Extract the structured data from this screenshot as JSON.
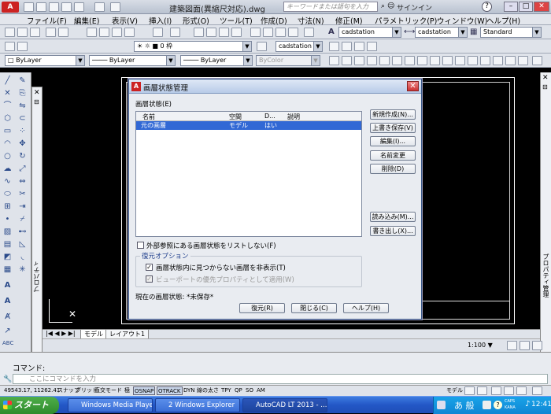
{
  "titlebar": {
    "title": "建築図面(異縮尺対応).dwg",
    "search_placeholder": "キーワードまたは語句を入力",
    "signin": "サインイン"
  },
  "menu": [
    "ファイル(F)",
    "編集(E)",
    "表示(V)",
    "挿入(I)",
    "形式(O)",
    "ツール(T)",
    "作成(D)",
    "寸法(N)",
    "修正(M)",
    "パラメトリック(P)",
    "ウィンドウ(W)",
    "ヘルプ(H)"
  ],
  "toolbar2": {
    "textstyle": "cadstation",
    "dimstyle": "cadstation",
    "tablestyle": "Standard",
    "mlstyle": "cadstation",
    "layer": "0 枠"
  },
  "toolbar3": {
    "color": "ByLayer",
    "linetype": "ByLayer",
    "lineweight": "ByLayer",
    "plotstyle": "ByColor"
  },
  "palettes": {
    "left_label": "プロパティ",
    "right_label": "プロパティ管理"
  },
  "layout_tabs": [
    "モデル",
    "レイアウト1"
  ],
  "scale": "1:100",
  "command": {
    "line1": "コマンド:",
    "placeholder": "ここにコマンドを入力"
  },
  "status": {
    "coords": "49543.17, 11262.41",
    "toggles": [
      "スナップ",
      "グリッド",
      "直交モード",
      "極",
      "OSNAP",
      "OTRACK",
      "DYN",
      "線の太さ",
      "TPY",
      "QP",
      "SO",
      "AM"
    ],
    "model": "モデル"
  },
  "taskbar": {
    "start": "スタート",
    "tasks": [
      "Windows Media Player",
      "2 Windows Explorer",
      "AutoCAD LT 2013 - ..."
    ],
    "ime": "あ 般",
    "caps": "CAPS KANA",
    "time": "12:41"
  },
  "dialog": {
    "title": "画層状態管理",
    "states_label": "画層状態(E)",
    "columns": [
      "名前",
      "空間",
      "D...",
      "説明"
    ],
    "rows": [
      {
        "name": "元の画層",
        "space": "モデル",
        "d": "はい",
        "desc": ""
      }
    ],
    "buttons_right": [
      "新規作成(N)...",
      "上書き保存(V)",
      "編集(I)...",
      "名前変更",
      "削除(D)"
    ],
    "buttons_lower": [
      "読み込み(M)...",
      "書き出し(X)..."
    ],
    "xref_checkbox": "外部参照にある画層状態をリストしない(F)",
    "restore_group": "復元オプション",
    "restore_opt1": "画層状態内に見つからない画層を非表示(T)",
    "restore_opt2": "ビューポートの優先プロパティとして適用(W)",
    "current_label": "現在の画層状態: *未保存*",
    "footer_buttons": [
      "復元(R)",
      "閉じる(C)",
      "ヘルプ(H)"
    ]
  },
  "colors": {
    "dialog_bg": "#e9ecf1",
    "selection": "#3168d5",
    "taskbar": "#2357c6",
    "canvas": "#000000"
  }
}
